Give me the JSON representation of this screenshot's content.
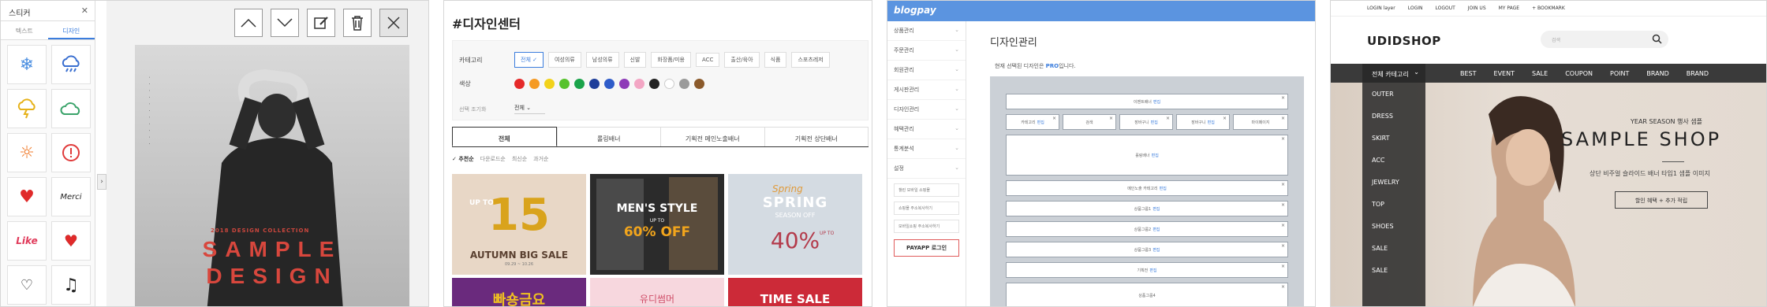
{
  "sticker_editor": {
    "panel_title": "스티커",
    "tabs": [
      "텍스트",
      "디자인"
    ],
    "stickers": [
      "snowflake-icon",
      "cloud-rain-icon",
      "thunder-icon",
      "cloud-icon",
      "sun-icon",
      "alert-icon",
      "heart-icon",
      "script-text",
      "like-text",
      "heart-outline-icon",
      "heart-small-icon",
      "music-note-icon"
    ],
    "script_text": "Merci",
    "like_text": "Like",
    "poster": {
      "subtitle": "2018 DESIGN COLLECTION",
      "title_line1": "SAMPLE",
      "title_line2": "DESIGN"
    }
  },
  "design_center": {
    "title": "#디자인센터",
    "filter": {
      "category_label": "카테고리",
      "categories": [
        "전체",
        "여성의류",
        "남성의류",
        "신발",
        "화장품/미용",
        "ACC",
        "출산/육아",
        "식품",
        "스포츠레저"
      ],
      "color_label": "색상",
      "colors": [
        "#e52a2a",
        "#f59a23",
        "#f2d21b",
        "#56c22c",
        "#1aa34a",
        "#1e3e9a",
        "#2f5cc9",
        "#8e3bb8",
        "#f3a6c4",
        "#222222",
        "#ffffff",
        "#9a9a9a",
        "#8b5a2b"
      ],
      "select_label": "선택 조기화",
      "select_value": "전체"
    },
    "tabs": [
      "전체",
      "롤링배너",
      "기획전 메인노출배너",
      "기획전 상단배너"
    ],
    "sort": [
      "추천순",
      "다운로드순",
      "최신순",
      "과거순"
    ],
    "thumbs": {
      "t1_up": "UP TO",
      "t1_num": "15",
      "t1_caption": "AUTUMN BIG SALE",
      "t1_date": "09.29 ~ 10.26",
      "t2_title": "MEN'S STYLE",
      "t2_upto": "UP TO",
      "t2_off": "60% OFF",
      "t3_script": "Spring",
      "t3_title": "SPRING",
      "t3_season": "SEASON OFF",
      "t3_upto": "UP TO",
      "t3_pct": "40%",
      "t4_text": "빠숑금요",
      "t5_text": "유디썸머",
      "t6_text": "TIME SALE"
    }
  },
  "blogpay": {
    "logo": "blogpay",
    "menu": [
      "상품관리",
      "주문관리",
      "회원관리",
      "게시판관리",
      "디자인관리",
      "혜택관리",
      "통계분석",
      "설정"
    ],
    "shop_links": [
      "챌린 모바일 쇼핑몰",
      "쇼핑몰 주소복사하기",
      "모바일쇼핑 주소복사하기"
    ],
    "login_btn": "PAYAPP 로그인",
    "page_title": "디자인관리",
    "note_prefix": "현재 선택된 디자인은",
    "note_pro": "PRO",
    "note_suffix": "입니다.",
    "edit_link": "편집",
    "boxes": {
      "top": "이벤트배너",
      "row": [
        "카테고리",
        "검색",
        "장바구니",
        "장바구니",
        "마이페이지"
      ],
      "rolling": "롤링배너",
      "product_banner": "메인노출 카테고리",
      "group1": "상품그룹1",
      "group2": "상품그룹2",
      "group3": "상품그룹3",
      "special": "기획전",
      "bottom": "상품그룹4"
    }
  },
  "udidshop": {
    "top_links": [
      "LOGIN layer",
      "LOGIN",
      "LOGOUT",
      "JOIN US",
      "MY PAGE",
      "+ BOOKMARK"
    ],
    "logo": "UDIDSHOP",
    "search_placeholder": "검색",
    "all_category": "전체 카테고리",
    "nav": [
      "BEST",
      "EVENT",
      "SALE",
      "COUPON",
      "POINT",
      "BRAND",
      "BRAND"
    ],
    "categories": [
      "OUTER",
      "DRESS",
      "SKIRT",
      "ACC",
      "JEWELRY",
      "TOP",
      "SHOES",
      "SALE",
      "SALE"
    ],
    "hero": {
      "year": "YEAR SEASON 행사 샘플",
      "title": "SAMPLE SHOP",
      "desc": "상단 비주얼 슬라이드 배너 타입1 샘플 이미지",
      "button": "할인 혜택 + 추가 적립"
    }
  }
}
